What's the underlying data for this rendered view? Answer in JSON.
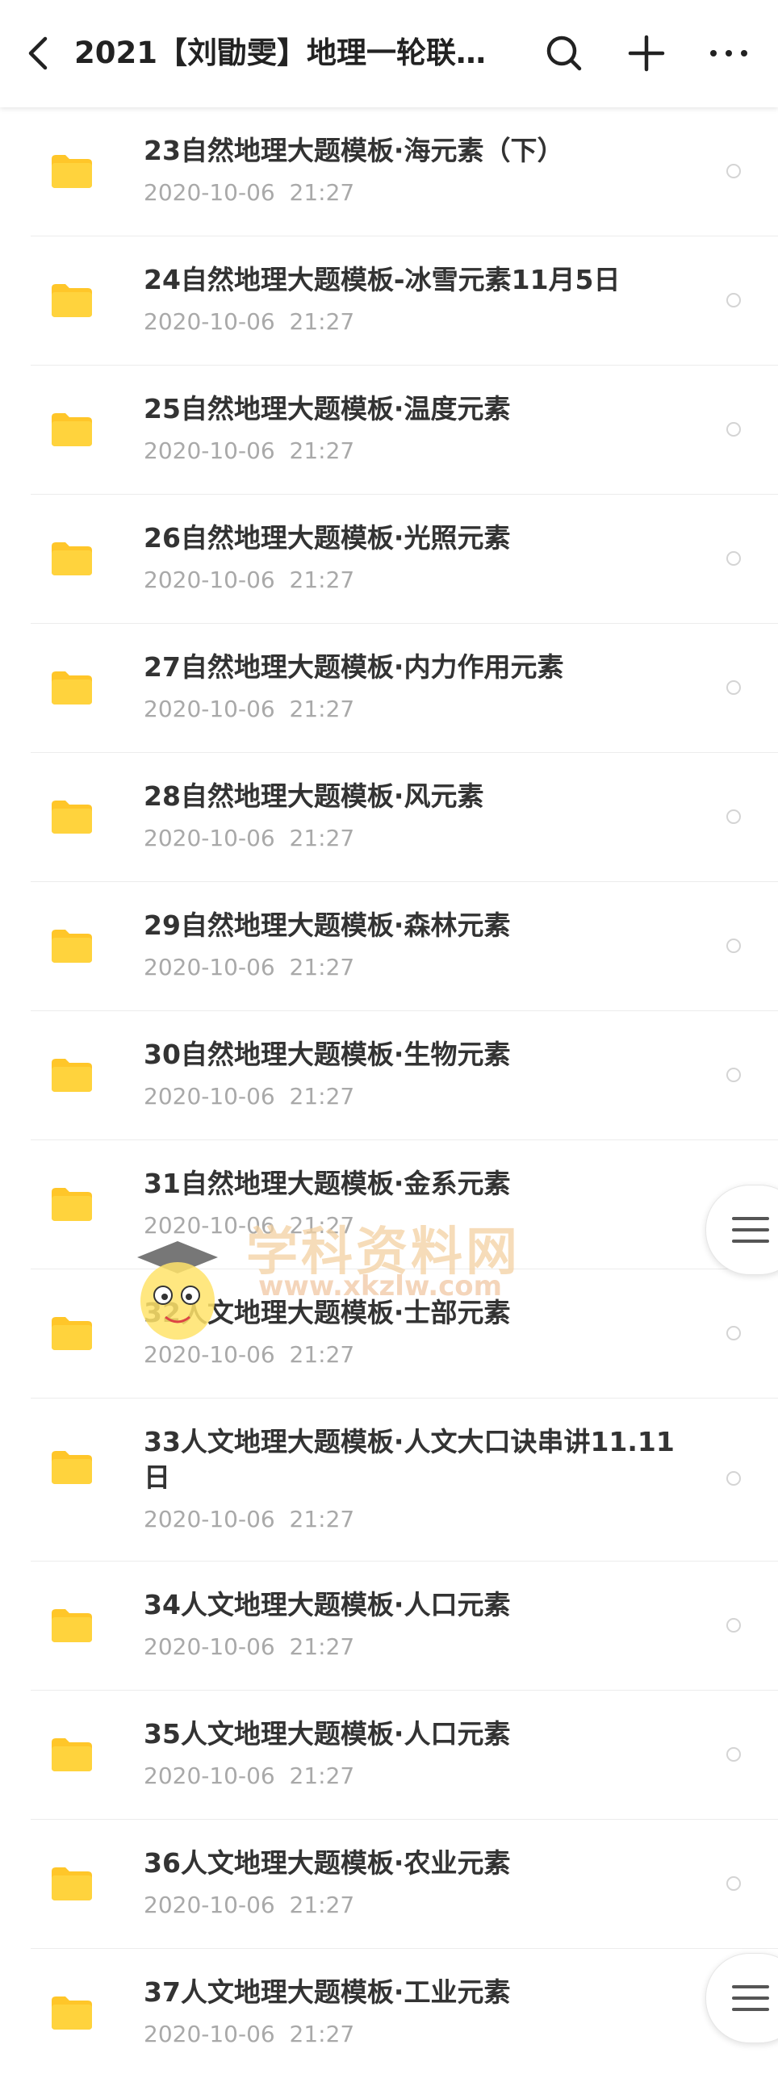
{
  "header": {
    "title": "2021【刘勖雯】地理一轮联…",
    "back_icon": "chevron-left-icon",
    "search_icon": "search-icon",
    "add_icon": "plus-icon",
    "more_icon": "more-horizontal-icon"
  },
  "files": [
    {
      "name": "23自然地理大题模板·海元素（下）",
      "date": "2020-10-06  21:27"
    },
    {
      "name": "24自然地理大题模板-冰雪元素11月5日",
      "date": "2020-10-06  21:27"
    },
    {
      "name": "25自然地理大题模板·温度元素",
      "date": "2020-10-06  21:27"
    },
    {
      "name": "26自然地理大题模板·光照元素",
      "date": "2020-10-06  21:27"
    },
    {
      "name": "27自然地理大题模板·内力作用元素",
      "date": "2020-10-06  21:27"
    },
    {
      "name": "28自然地理大题模板·风元素",
      "date": "2020-10-06  21:27"
    },
    {
      "name": "29自然地理大题模板·森林元素",
      "date": "2020-10-06  21:27"
    },
    {
      "name": "30自然地理大题模板·生物元素",
      "date": "2020-10-06  21:27"
    },
    {
      "name": "31自然地理大题模板·金系元素",
      "date": "2020-10-06  21:27"
    },
    {
      "name": "32人文地理大题模板·士部元素",
      "date": "2020-10-06  21:27"
    },
    {
      "name": "33人文地理大题模板·人文大口诀串讲11.11日",
      "date": "2020-10-06  21:27"
    },
    {
      "name": "34人文地理大题模板·人口元素",
      "date": "2020-10-06  21:27"
    },
    {
      "name": "35人文地理大题模板·人口元素",
      "date": "2020-10-06  21:27"
    },
    {
      "name": "36人文地理大题模板·农业元素",
      "date": "2020-10-06  21:27"
    },
    {
      "name": "37人文地理大题模板·工业元素",
      "date": "2020-10-06  21:27"
    }
  ],
  "watermark": {
    "text": "学科资料网",
    "url": "www.xkzlw.com"
  },
  "colors": {
    "folder": "#FFC629",
    "title_text": "#333333",
    "date_text": "#A9A9A9",
    "divider": "#ECECEC"
  }
}
